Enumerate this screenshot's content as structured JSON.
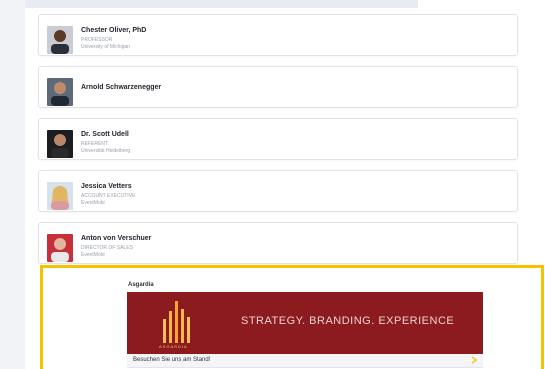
{
  "speakers": [
    {
      "name": "Chester Oliver, PhD",
      "title": "PROFESSOR",
      "org": "University of Michigan"
    },
    {
      "name": "Arnold Schwarzenegger",
      "title": "",
      "org": ""
    },
    {
      "name": "Dr. Scott Udell",
      "title": "REFERENT",
      "org": "Universität Heidelberg"
    },
    {
      "name": "Jessica Vetters",
      "title": "ACCOUNT EXECUTIVE",
      "org": "EventMobi"
    },
    {
      "name": "Anton von Verschuer",
      "title": "DIRECTOR OF SALES",
      "org": "EventMobi"
    }
  ],
  "sponsor": {
    "name": "Asgardia",
    "logo_text": "ASGARDIA",
    "tagline": "STRATEGY. BRANDING. EXPERIENCE",
    "cta": "Besuchen Sie uns am Stand!"
  },
  "colors": {
    "highlight_border": "#f5c200",
    "banner_bg": "#8c1b1f",
    "cta_arrow": "#f5c200"
  }
}
